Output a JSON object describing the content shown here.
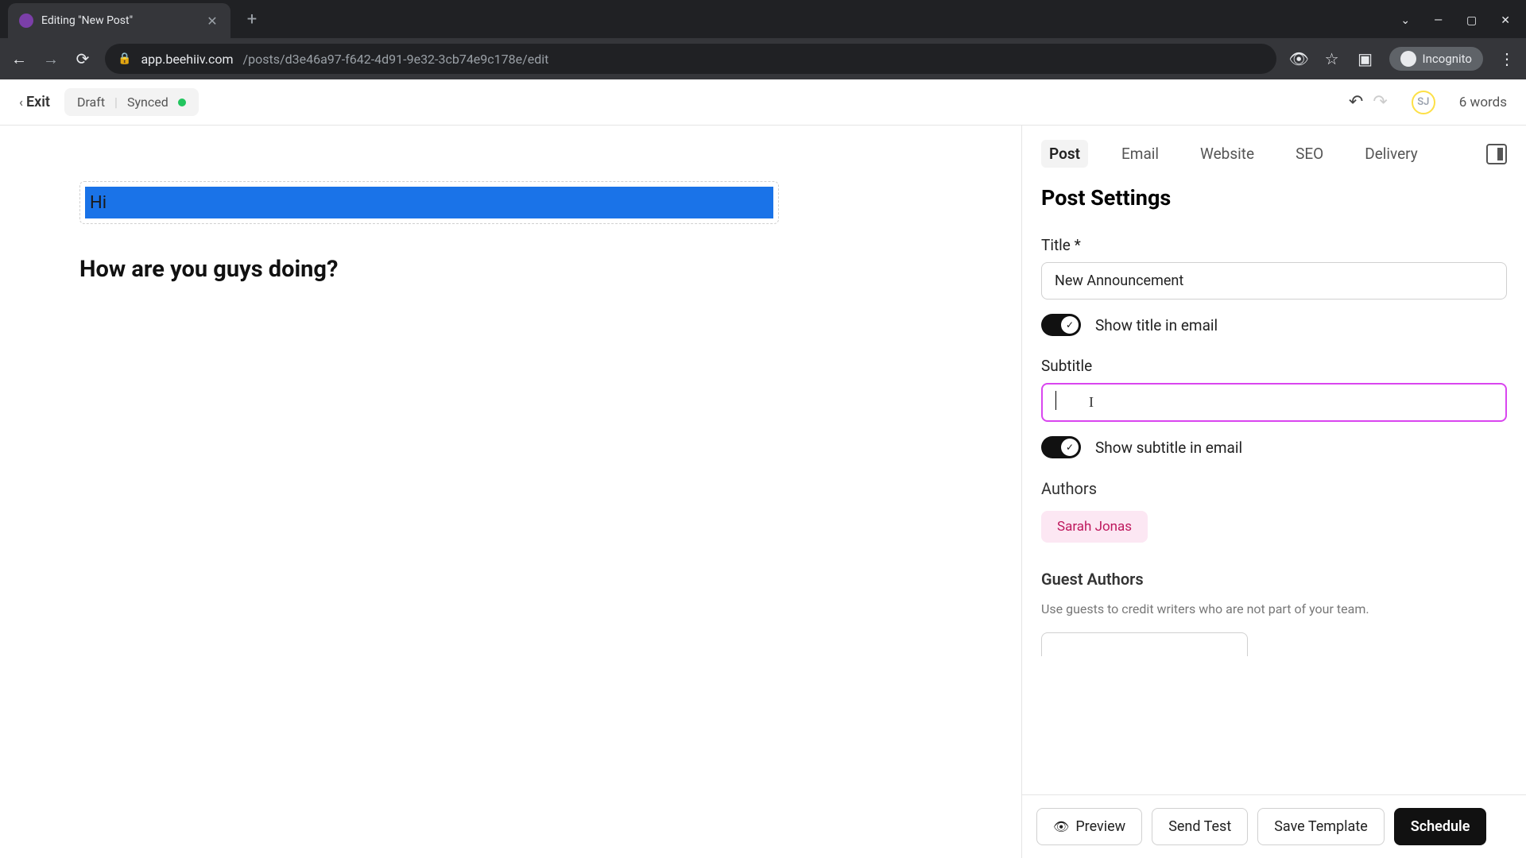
{
  "browser": {
    "tab_title": "Editing \"New Post\"",
    "url_host": "app.beehiiv.com",
    "url_path": "/posts/d3e46a97-f642-4d91-9e32-3cb74e9c178e/edit",
    "incognito_label": "Incognito"
  },
  "toolbar": {
    "exit_label": "Exit",
    "status_draft": "Draft",
    "status_synced": "Synced",
    "avatar_initials": "SJ",
    "word_count": "6 words"
  },
  "editor": {
    "highlighted_text": "Hi",
    "heading_text": "How are you guys doing?"
  },
  "sidebar": {
    "tabs": {
      "post": "Post",
      "email": "Email",
      "website": "Website",
      "seo": "SEO",
      "delivery": "Delivery"
    },
    "settings_title": "Post Settings",
    "title_label": "Title *",
    "title_value": "New Announcement",
    "show_title_label": "Show title in email",
    "subtitle_label": "Subtitle",
    "subtitle_value": "",
    "show_subtitle_label": "Show subtitle in email",
    "authors_label": "Authors",
    "author_name": "Sarah Jonas",
    "guest_authors_label": "Guest Authors",
    "guest_authors_desc": "Use guests to credit writers who are not part of your team."
  },
  "footer": {
    "preview": "Preview",
    "send_test": "Send Test",
    "save_template": "Save Template",
    "schedule": "Schedule"
  }
}
